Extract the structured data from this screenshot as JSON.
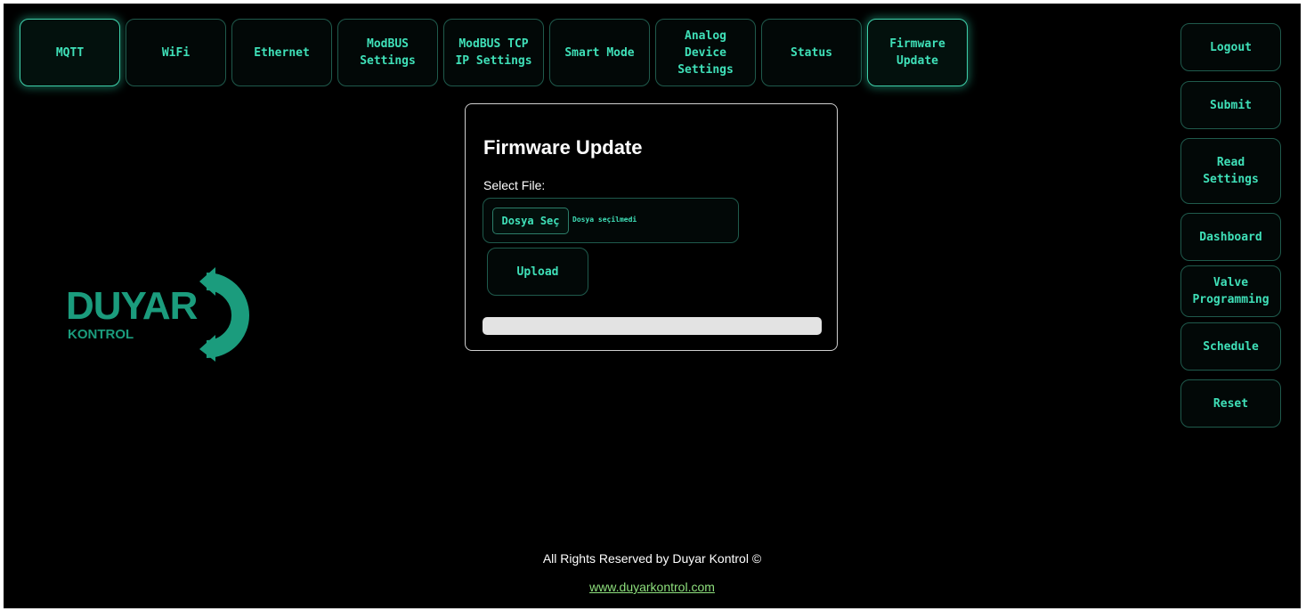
{
  "nav_tabs": [
    {
      "label": "MQTT"
    },
    {
      "label": "WiFi"
    },
    {
      "label": "Ethernet"
    },
    {
      "label": "ModBUS\nSettings"
    },
    {
      "label": "ModBUS TCP\nIP Settings"
    },
    {
      "label": "Smart Mode"
    },
    {
      "label": "Analog\nDevice\nSettings"
    },
    {
      "label": "Status"
    },
    {
      "label": "Firmware\nUpdate"
    }
  ],
  "sidebar": [
    {
      "label": "Logout"
    },
    {
      "label": "Submit"
    },
    {
      "label": "Read\nSettings"
    },
    {
      "label": "Dashboard"
    },
    {
      "label": "Valve\nProgramming"
    },
    {
      "label": "Schedule"
    },
    {
      "label": "Reset"
    }
  ],
  "logo": {
    "name": "DUYAR",
    "subtitle": "KONTROL"
  },
  "firmware": {
    "title": "Firmware Update",
    "select_label": "Select File:",
    "file_button": "Dosya Seç",
    "file_status": "Dosya seçilmedi",
    "upload_button": "Upload",
    "progress_fraction": 0
  },
  "footer": {
    "copyright": "All Rights Reserved by Duyar Kontrol ©",
    "link": "www.duyarkontrol.com"
  },
  "colors": {
    "accent": "#3fe0b8",
    "brand": "#1b9c7d",
    "link": "#8ee07d",
    "background": "#000000"
  }
}
